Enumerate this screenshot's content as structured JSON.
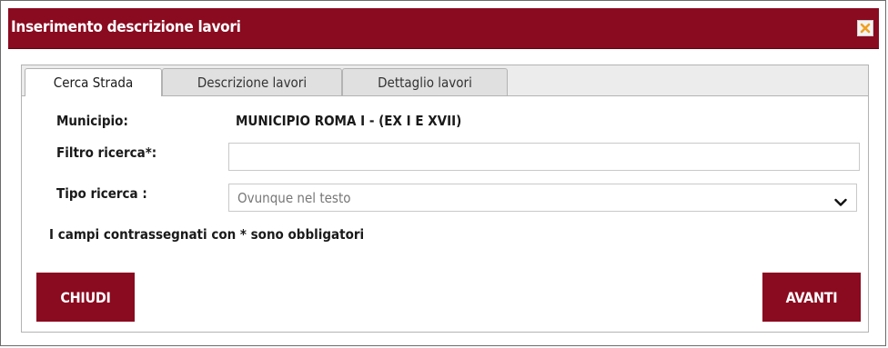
{
  "dialog": {
    "title": "Inserimento descrizione lavori"
  },
  "tabs": [
    {
      "label": "Cerca Strada",
      "active": true
    },
    {
      "label": "Descrizione lavori",
      "active": false
    },
    {
      "label": "Dettaglio lavori",
      "active": false
    }
  ],
  "form": {
    "municipio_label": "Municipio:",
    "municipio_value": "MUNICIPIO ROMA I - (EX I E XVII)",
    "filtro_label": "Filtro ricerca*:",
    "filtro_value": "",
    "tipo_label": "Tipo ricerca :",
    "tipo_selected": "Ovunque nel testo",
    "required_note": "I campi contrassegnati con * sono obbligatori"
  },
  "buttons": {
    "close_label": "CHIUDI",
    "next_label": "AVANTI"
  },
  "colors": {
    "accent": "#8a0a1f",
    "close_icon": "#f0a020"
  },
  "icons": {
    "close": "close-icon",
    "dropdown": "chevron-down-icon"
  }
}
